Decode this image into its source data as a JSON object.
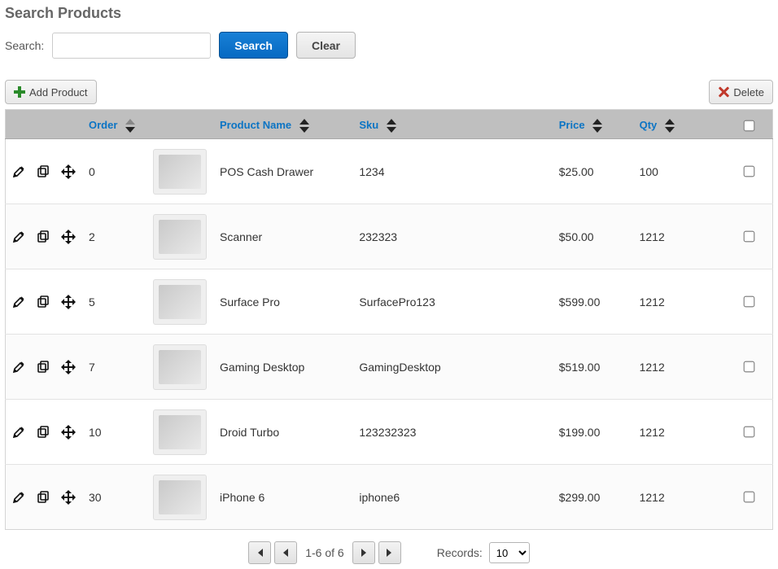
{
  "title": "Search Products",
  "search": {
    "label": "Search:",
    "button": "Search",
    "clear": "Clear",
    "value": ""
  },
  "toolbar": {
    "add": "Add Product",
    "delete": "Delete"
  },
  "columns": {
    "order": "Order",
    "name": "Product Name",
    "sku": "Sku",
    "price": "Price",
    "qty": "Qty"
  },
  "rows": [
    {
      "order": "0",
      "name": "POS Cash Drawer",
      "sku": "1234",
      "price": "$25.00",
      "qty": "100"
    },
    {
      "order": "2",
      "name": "Scanner",
      "sku": "232323",
      "price": "$50.00",
      "qty": "1212"
    },
    {
      "order": "5",
      "name": "Surface Pro",
      "sku": "SurfacePro123",
      "price": "$599.00",
      "qty": "1212"
    },
    {
      "order": "7",
      "name": "Gaming Desktop",
      "sku": "GamingDesktop",
      "price": "$519.00",
      "qty": "1212"
    },
    {
      "order": "10",
      "name": "Droid Turbo",
      "sku": "123232323",
      "price": "$199.00",
      "qty": "1212"
    },
    {
      "order": "30",
      "name": "iPhone 6",
      "sku": "iphone6",
      "price": "$299.00",
      "qty": "1212"
    }
  ],
  "pager": {
    "status": "1-6 of 6",
    "recordsLabel": "Records:",
    "recordsValue": "10"
  }
}
